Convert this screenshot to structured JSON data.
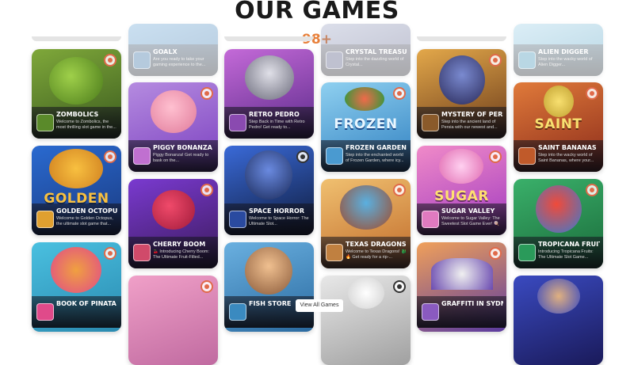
{
  "header": {
    "title": "OUR GAMES",
    "count": "98+"
  },
  "view_all_label": "View All Games",
  "games": [
    {
      "name": "GOALX",
      "desc": "Are you ready to take your gaming experience to the...",
      "colors": [
        "#6aa7d8",
        "#2e6aa0"
      ]
    },
    {
      "name": "CRYSTAL TREASURE",
      "desc": "Step into the dazzling world of Crystal...",
      "colors": [
        "#9aa3c4",
        "#4a4f7a"
      ]
    },
    {
      "name": "ALIEN DIGGER",
      "desc": "Step into the wacky world of Alien Digger...",
      "colors": [
        "#9bd0e8",
        "#3a8fb5"
      ]
    },
    {
      "name": "ZOMBOLICS",
      "desc": "Welcome to Zombolics, the most thrilling slot game in the...",
      "colors": [
        "#7fa83a",
        "#3a5a1e"
      ]
    },
    {
      "name": "RETRO PEDRO",
      "desc": "Step Back in Time with Retro Pedro! Get ready to...",
      "colors": [
        "#c46ad8",
        "#5b2a8a"
      ]
    },
    {
      "name": "MYSTERY OF PERSIA",
      "desc": "Step into the ancient land of Persia with our newest and...",
      "colors": [
        "#e3a84a",
        "#6a3a1a"
      ]
    },
    {
      "name": "PIGGY BONANZA",
      "desc": "Piggy Bonanza! Get ready to bask on the...",
      "colors": [
        "#b58be0",
        "#7a3fbf"
      ]
    },
    {
      "name": "FROZEN GARDEN",
      "desc": "Step into the enchanted world of Frozen Garden, where icy...",
      "colors": [
        "#8fd0f0",
        "#2f7fc0"
      ]
    },
    {
      "name": "SAINT BANANAS",
      "desc": "Step into the wacky world of Saint Bananas, where your...",
      "colors": [
        "#e07a3a",
        "#8a2a1a"
      ]
    },
    {
      "name": "GOLDEN OCTOPUS",
      "desc": "Welcome to Golden Octopus, the ultimate slot game that...",
      "colors": [
        "#f0a030",
        "#2a6ad0"
      ]
    },
    {
      "name": "SPACE HORROR",
      "desc": "Welcome to Space Horror: The Ultimate Slot...",
      "colors": [
        "#3a6ad8",
        "#0e1a3a"
      ]
    },
    {
      "name": "SUGAR VALLEY",
      "desc": "Welcome to Sugar Valley: The Sweetest Slot Game Ever! 🍭",
      "colors": [
        "#f08ac8",
        "#a03ac0"
      ]
    },
    {
      "name": "CHERRY BOOM",
      "desc": "🍒 Introducing Cherry Boom: The Ultimate Fruit-Filled...",
      "colors": [
        "#d04a8a",
        "#3a1a5a"
      ]
    },
    {
      "name": "TEXAS DRAGONS",
      "desc": "Welcome to Texas Dragons! 🐉🔥 Get ready for a rip-...",
      "colors": [
        "#f0c070",
        "#c06a2a"
      ]
    },
    {
      "name": "TROPICANA FRUITS",
      "desc": "Introducing Tropicana Fruits: The Ultimate Slot Game...",
      "colors": [
        "#3ab06a",
        "#1a6a3a"
      ]
    },
    {
      "name": "BOOK OF PINATA",
      "desc": "",
      "colors": [
        "#4ac0e0",
        "#e04a8a"
      ]
    },
    {
      "name": "FISH STORE",
      "desc": "",
      "colors": [
        "#6ab0e0",
        "#2a6aa0"
      ]
    },
    {
      "name": "GRAFFITI IN SYDNEY",
      "desc": "",
      "colors": [
        "#f0a05a",
        "#5a3aa0"
      ]
    },
    {
      "name": "",
      "desc": "",
      "colors": [
        "#f0a0c8",
        "#c06aa0"
      ]
    },
    {
      "name": "",
      "desc": "",
      "colors": [
        "#e0e0e0",
        "#a0a0a0"
      ]
    },
    {
      "name": "",
      "desc": "",
      "colors": [
        "#3a4ac0",
        "#1a1a5a"
      ]
    }
  ],
  "logos": {
    "frozen": "FROZEN",
    "saint": "SAINT",
    "golden": "GOLDEN",
    "sugar": "SUGAR"
  }
}
